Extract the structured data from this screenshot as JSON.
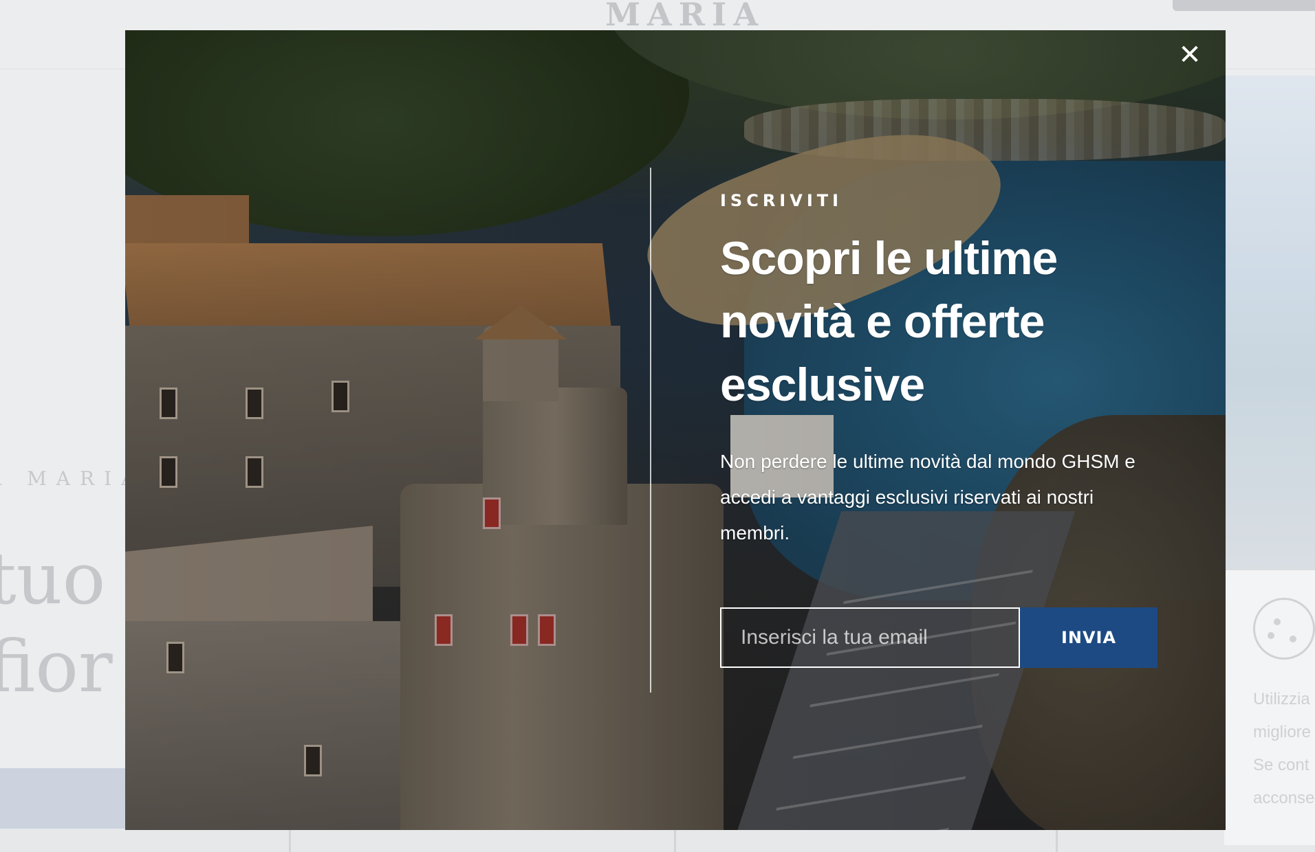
{
  "background_page": {
    "top_logo": "MARIA",
    "side_logo": "A MARIA",
    "hero_line_1": "tuo",
    "hero_line_2": "fior",
    "cookie_lines": [
      "Utilizzia",
      "migliore",
      "Se cont",
      "acconse"
    ]
  },
  "modal": {
    "close_symbol": "✕",
    "eyebrow": "ISCRIVITI",
    "headline": "Scopri le ultime novità e offerte esclusive",
    "description": "Non perdere le ultime novità dal mondo GHSM e accedi a vantaggi esclusivi riservati ai nostri membri.",
    "email_placeholder": "Inserisci la tua email",
    "email_value": "",
    "submit_label": "INVIA",
    "accent_color": "#1d4a82"
  }
}
